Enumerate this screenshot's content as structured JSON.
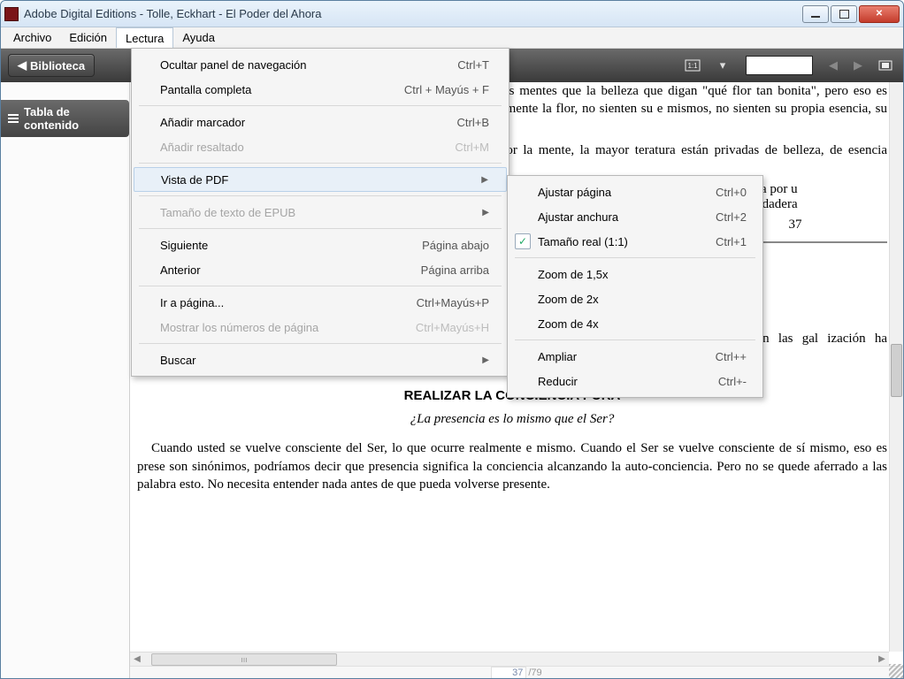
{
  "window": {
    "title": "Adobe Digital Editions - Tolle, Eckhart - El Poder del Ahora"
  },
  "menubar": {
    "items": [
      "Archivo",
      "Edición",
      "Lectura",
      "Ayuda"
    ],
    "active_index": 2
  },
  "toolbar": {
    "library_label": "Biblioteca"
  },
  "sidepanel": {
    "toc_label": "Tabla de contenido"
  },
  "status": {
    "current_page": "37",
    "page_sep": " /",
    "total_pages": "79"
  },
  "menu_lectura": {
    "items": [
      {
        "label": "Ocultar panel de navegación",
        "accel": "Ctrl+T"
      },
      {
        "label": "Pantalla completa",
        "accel": "Ctrl + Mayús + F"
      },
      {
        "sep": true
      },
      {
        "label": "Añadir marcador",
        "accel": "Ctrl+B"
      },
      {
        "label": "Añadir resaltado",
        "accel": "Ctrl+M",
        "disabled": true
      },
      {
        "sep": true
      },
      {
        "label": "Vista de PDF",
        "submenu": true,
        "highlight": true
      },
      {
        "sep": true
      },
      {
        "label": "Tamaño de texto de EPUB",
        "submenu": true,
        "disabled": true
      },
      {
        "sep": true
      },
      {
        "label": "Siguiente",
        "accel": "Página abajo"
      },
      {
        "label": "Anterior",
        "accel": "Página arriba"
      },
      {
        "sep": true
      },
      {
        "label": "Ir a página...",
        "accel": "Ctrl+Mayús+P"
      },
      {
        "label": "Mostrar los números de página",
        "accel": "Ctrl+Mayús+H",
        "disabled": true
      },
      {
        "sep": true
      },
      {
        "label": "Buscar",
        "submenu": true
      }
    ]
  },
  "submenu_pdf": {
    "items": [
      {
        "label": "Ajustar página",
        "accel": "Ctrl+0"
      },
      {
        "label": "Ajustar anchura",
        "accel": "Ctrl+2"
      },
      {
        "label": "Tamaño real (1:1)",
        "accel": "Ctrl+1",
        "checked": true
      },
      {
        "sep": true
      },
      {
        "label": "Zoom de 1,5x"
      },
      {
        "label": "Zoom de 2x"
      },
      {
        "label": "Zoom de 4x"
      },
      {
        "sep": true
      },
      {
        "label": "Ampliar",
        "accel": "Ctrl++"
      },
      {
        "label": "Reducir",
        "accel": "Ctrl+-"
      }
    ]
  },
  "content": {
    "p1": "sonas son tan prisioneras de sus mentes que la belleza que digan \"qué flor tan bonita\", pero eso es solamente , presentes, no ven realmente la flor, no sienten su e mismos, no sienten su propia esencia, su santidad.",
    "p2": "s en una cultura tan dominada por la mente, la mayor teratura están privadas de belleza, de esencia interior,",
    "p3a": "- ni siquiera por u",
    "p3b": "onde la verdadera",
    "pgnum_top": "37",
    "p4": "no sólo en las gal ización ha produci",
    "heading": "REALIZAR LA CONCIENCIA PURA",
    "subhead": "¿La presencia es lo mismo que el Ser?",
    "p5": "Cuando usted se vuelve consciente del Ser, lo que ocurre realmente e mismo. Cuando el Ser se vuelve consciente de sí mismo, eso es prese son sinónimos, podríamos decir que presencia significa la conciencia alcanzando la auto-conciencia. Pero no se quede aferrado a las palabra esto. No necesita entender nada antes de que pueda volverse presente.",
    "hscroll_marks": "ııı"
  }
}
